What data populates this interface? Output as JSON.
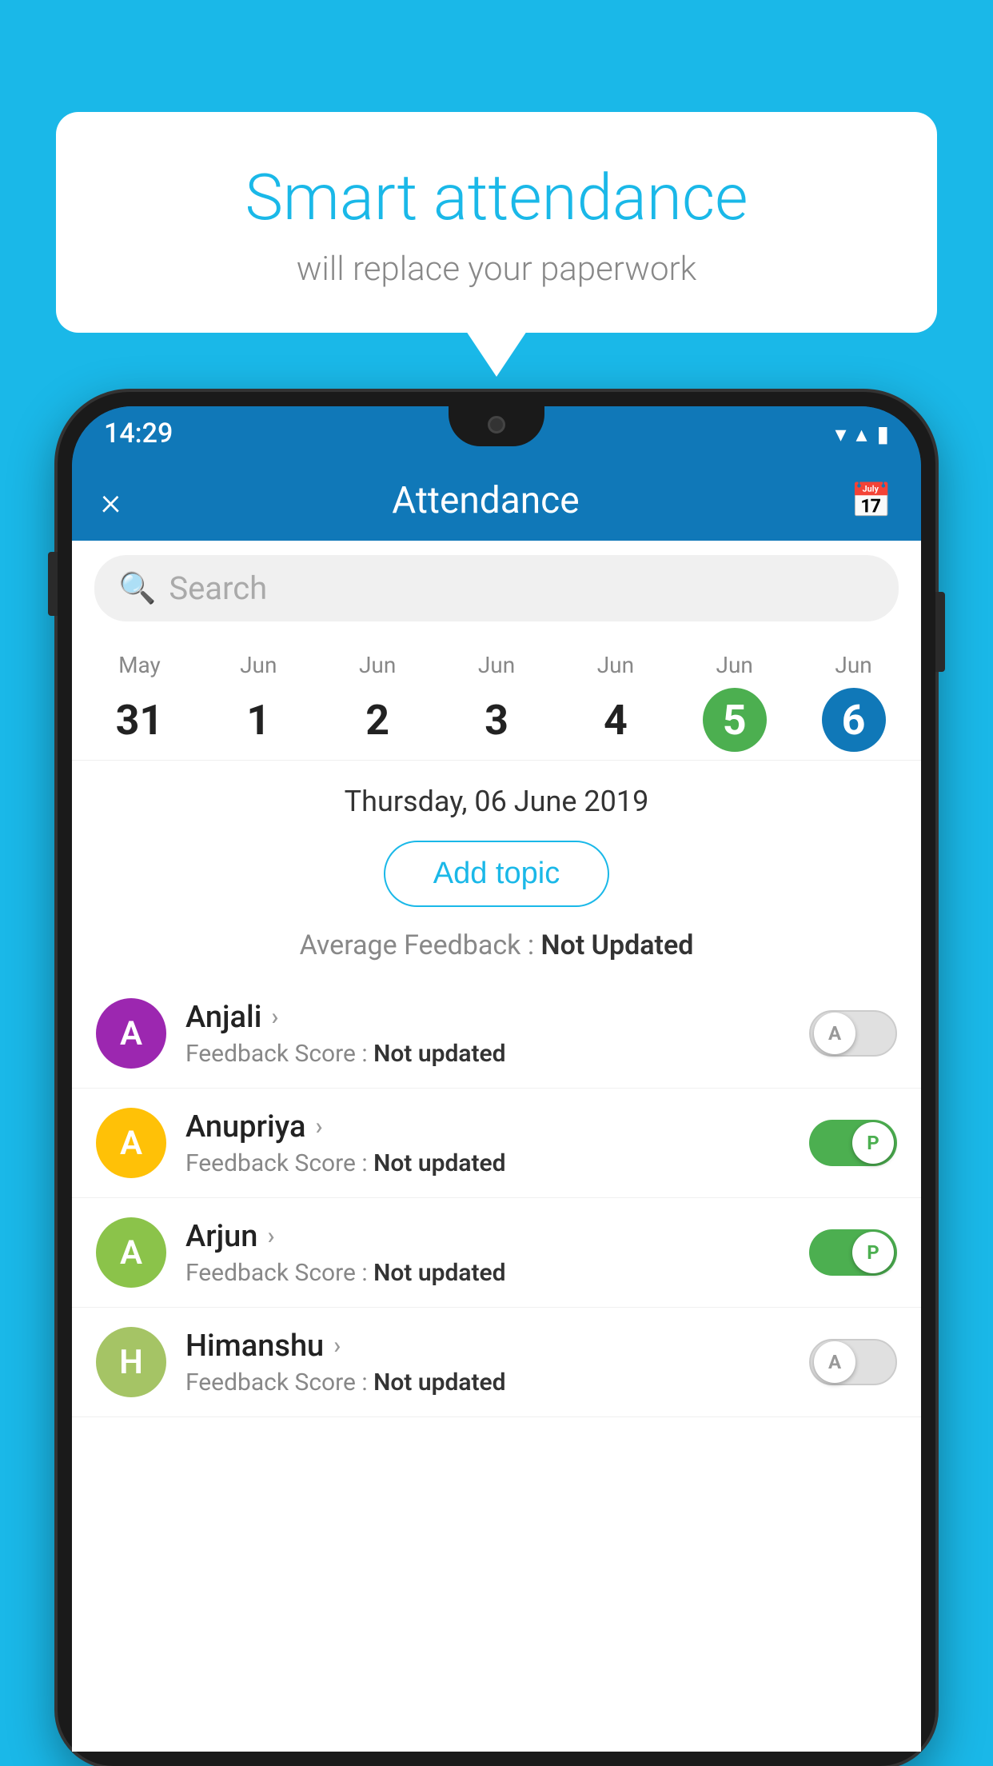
{
  "background_color": "#1ab8e8",
  "speech_bubble": {
    "title": "Smart attendance",
    "subtitle": "will replace your paperwork"
  },
  "status_bar": {
    "time": "14:29",
    "wifi_icon": "▼",
    "signal_icon": "▲",
    "battery_icon": "▮"
  },
  "app_bar": {
    "title": "Attendance",
    "close_label": "×",
    "calendar_icon": "📅"
  },
  "search": {
    "placeholder": "Search"
  },
  "calendar": {
    "days": [
      {
        "month": "May",
        "num": "31",
        "state": "normal"
      },
      {
        "month": "Jun",
        "num": "1",
        "state": "normal"
      },
      {
        "month": "Jun",
        "num": "2",
        "state": "normal"
      },
      {
        "month": "Jun",
        "num": "3",
        "state": "normal"
      },
      {
        "month": "Jun",
        "num": "4",
        "state": "normal"
      },
      {
        "month": "Jun",
        "num": "5",
        "state": "today"
      },
      {
        "month": "Jun",
        "num": "6",
        "state": "selected"
      }
    ]
  },
  "selected_date": "Thursday, 06 June 2019",
  "add_topic_label": "Add topic",
  "avg_feedback": {
    "label": "Average Feedback : ",
    "value": "Not Updated"
  },
  "students": [
    {
      "name": "Anjali",
      "avatar_letter": "A",
      "avatar_color": "#9c27b0",
      "feedback_label": "Feedback Score : ",
      "feedback_value": "Not updated",
      "toggle_state": "off",
      "toggle_label": "A"
    },
    {
      "name": "Anupriya",
      "avatar_letter": "A",
      "avatar_color": "#ffc107",
      "feedback_label": "Feedback Score : ",
      "feedback_value": "Not updated",
      "toggle_state": "on",
      "toggle_label": "P"
    },
    {
      "name": "Arjun",
      "avatar_letter": "A",
      "avatar_color": "#8bc34a",
      "feedback_label": "Feedback Score : ",
      "feedback_value": "Not updated",
      "toggle_state": "on",
      "toggle_label": "P"
    },
    {
      "name": "Himanshu",
      "avatar_letter": "H",
      "avatar_color": "#a5c465",
      "feedback_label": "Feedback Score : ",
      "feedback_value": "Not updated",
      "toggle_state": "off",
      "toggle_label": "A"
    }
  ]
}
